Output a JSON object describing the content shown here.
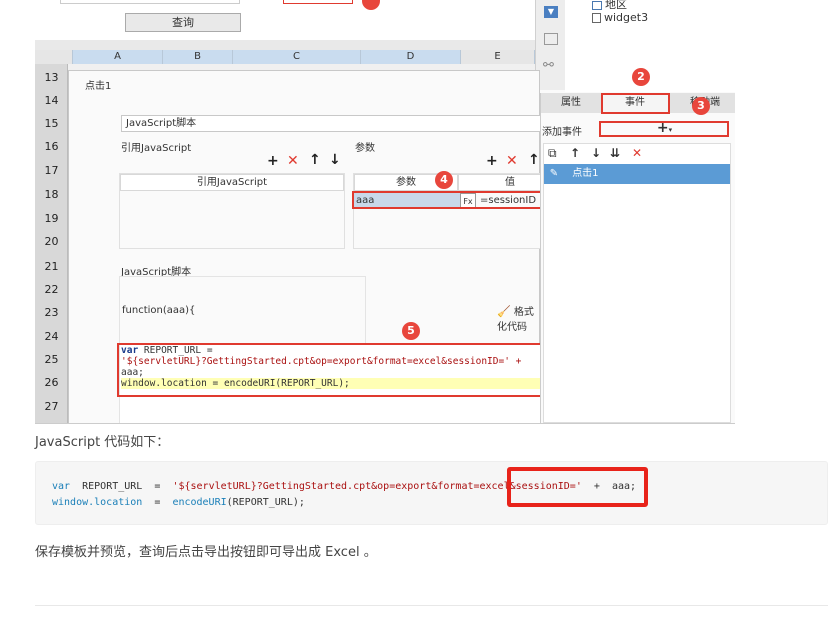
{
  "top_area": {
    "query_button": "查询",
    "tree_items": [
      "地区",
      "widget3"
    ]
  },
  "sheet": {
    "columns": [
      "A",
      "B",
      "C",
      "D",
      "E"
    ],
    "rows": [
      "13",
      "14",
      "15",
      "16",
      "17",
      "18",
      "19",
      "20",
      "21",
      "22",
      "23",
      "24",
      "25",
      "26",
      "27"
    ]
  },
  "dialog": {
    "title": "点击1",
    "script_type": "JavaScript脚本",
    "ref_js_label": "引用JavaScript",
    "ref_js_column": "引用JavaScript",
    "params_label": "参数",
    "params_columns": [
      "参数",
      "值"
    ],
    "param_row": {
      "name": "aaa",
      "value": "=sessionID"
    },
    "script_section": "JavaScript脚本",
    "function_sig": "function(aaa){",
    "format_button": "格式化代码",
    "code_lines": [
      "var REPORT_URL =",
      "'${servletURL}?GettingStarted.cpt&op=export&format=excel&sessionID=' +",
      "aaa;",
      "window.location = encodeURI(REPORT_URL);"
    ]
  },
  "right_panel": {
    "tabs": [
      "属性",
      "事件",
      "移动端"
    ],
    "add_event_label": "添加事件",
    "event_item": "点击1"
  },
  "badges": [
    "2",
    "3",
    "4",
    "5"
  ],
  "article": {
    "intro": "JavaScript 代码如下：",
    "code_var": "var",
    "code_name": "REPORT_URL",
    "code_eq": "=",
    "code_string": "'${servletURL}?GettingStarted.cpt&op=export&format=excel&sessionID='",
    "code_plus": "+",
    "code_aaa": "aaa;",
    "code_line2_obj": "window.location",
    "code_line2_eq": "=",
    "code_line2_fn": "encodeURI",
    "code_line2_arg": "(REPORT_URL);",
    "outro": "保存模板并预览，查询后点击导出按钮即可导出成 Excel 。"
  },
  "colors": {
    "highlight_red": "#e03a2f",
    "selected_blue": "#5b9bd5",
    "code_string": "#a11",
    "code_keyword": "#1a7fb8"
  }
}
